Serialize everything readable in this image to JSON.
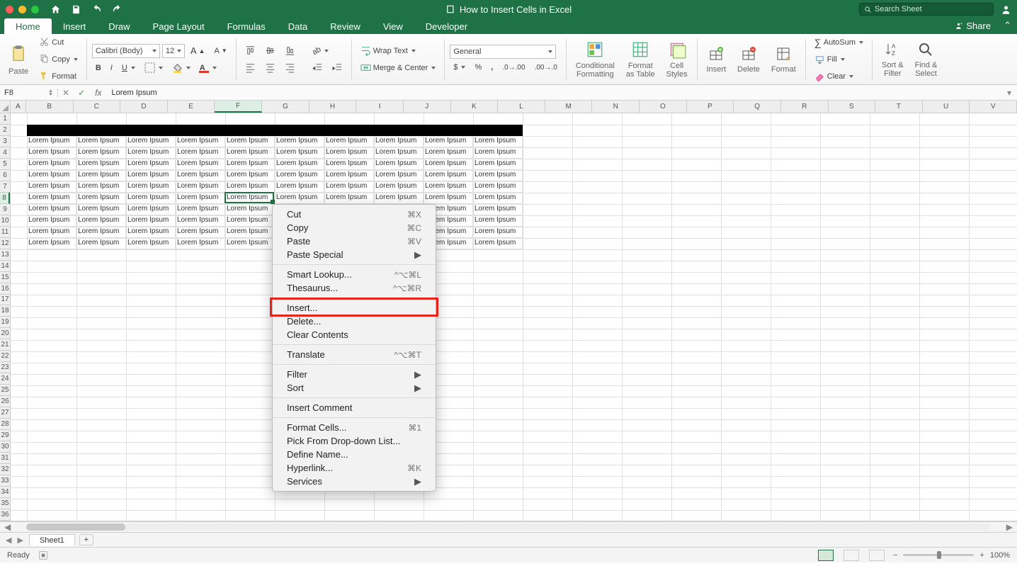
{
  "titlebar": {
    "doc_title": "How to Insert Cells in Excel",
    "search_placeholder": "Search Sheet"
  },
  "tabs": [
    "Home",
    "Insert",
    "Draw",
    "Page Layout",
    "Formulas",
    "Data",
    "Review",
    "View",
    "Developer"
  ],
  "share_label": "Share",
  "ribbon": {
    "paste": "Paste",
    "cut": "Cut",
    "copy": "Copy",
    "fmt": "Format",
    "font_name": "Calibri (Body)",
    "font_size": "12",
    "wrap": "Wrap Text",
    "merge": "Merge & Center",
    "number_format": "General",
    "cond_fmt": "Conditional\nFormatting",
    "fmt_table": "Format\nas Table",
    "cell_styles": "Cell\nStyles",
    "insert": "Insert",
    "delete": "Delete",
    "format": "Format",
    "autosum": "AutoSum",
    "fill": "Fill",
    "clear": "Clear",
    "sort_filter": "Sort &\nFilter",
    "find_select": "Find &\nSelect"
  },
  "fbar": {
    "name": "F8",
    "formula": "Lorem Ipsum"
  },
  "columns": [
    "A",
    "B",
    "C",
    "D",
    "E",
    "F",
    "G",
    "H",
    "I",
    "J",
    "K",
    "L",
    "M",
    "N",
    "O",
    "P",
    "Q",
    "R",
    "S",
    "T",
    "U",
    "V"
  ],
  "rows_count": 36,
  "cell_text": "Lorem Ipsum",
  "data_cols": [
    "B",
    "C",
    "D",
    "E",
    "F",
    "G",
    "H",
    "I",
    "J",
    "K"
  ],
  "data_rows": [
    3,
    4,
    5,
    6,
    7,
    8,
    9,
    10,
    11,
    12
  ],
  "black_row": 2,
  "selected_cell": {
    "col": "F",
    "row": 8
  },
  "context_menu": {
    "items": [
      {
        "label": "Cut",
        "kb": "⌘X"
      },
      {
        "label": "Copy",
        "kb": "⌘C"
      },
      {
        "label": "Paste",
        "kb": "⌘V"
      },
      {
        "label": "Paste Special",
        "sub": true
      },
      {
        "sep": true
      },
      {
        "label": "Smart Lookup...",
        "kb": "^⌥⌘L"
      },
      {
        "label": "Thesaurus...",
        "kb": "^⌥⌘R"
      },
      {
        "sep": true
      },
      {
        "label": "Insert...",
        "highlight": true
      },
      {
        "label": "Delete..."
      },
      {
        "label": "Clear Contents"
      },
      {
        "sep": true
      },
      {
        "label": "Translate",
        "kb": "^⌥⌘T"
      },
      {
        "sep": true
      },
      {
        "label": "Filter",
        "sub": true
      },
      {
        "label": "Sort",
        "sub": true
      },
      {
        "sep": true
      },
      {
        "label": "Insert Comment"
      },
      {
        "sep": true
      },
      {
        "label": "Format Cells...",
        "kb": "⌘1"
      },
      {
        "label": "Pick From Drop-down List..."
      },
      {
        "label": "Define Name..."
      },
      {
        "label": "Hyperlink...",
        "kb": "⌘K"
      },
      {
        "label": "Services",
        "sub": true
      }
    ]
  },
  "sheet_tab": "Sheet1",
  "status": {
    "ready": "Ready",
    "zoom": "100%"
  }
}
